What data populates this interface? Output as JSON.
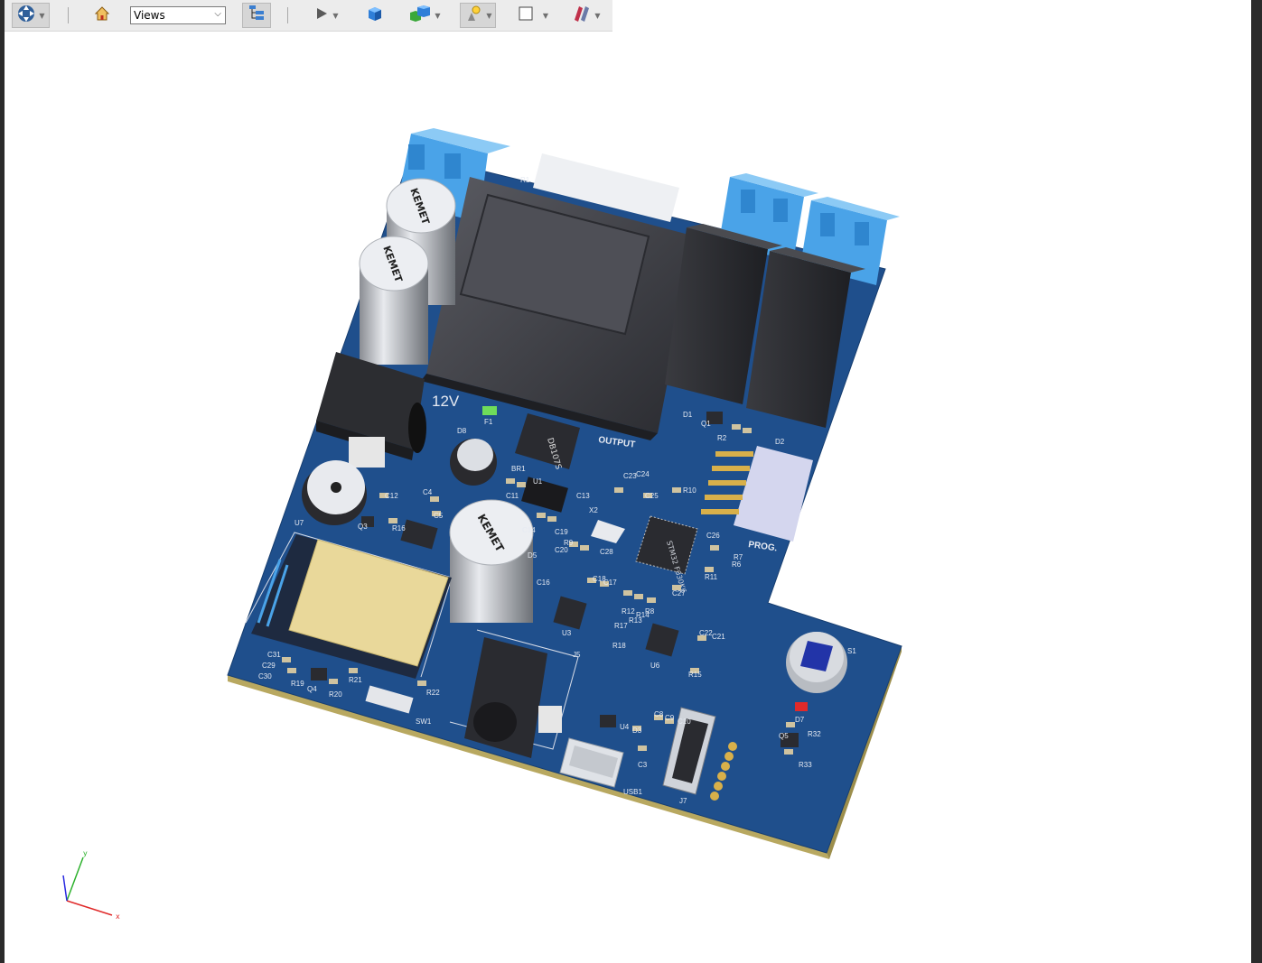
{
  "toolbar": {
    "views_label": "Views",
    "icons": [
      "navigate-icon",
      "home-icon",
      "model-tree-icon",
      "play-icon",
      "box-view-icon",
      "multi-box-icon",
      "lighting-icon",
      "display-mode-icon",
      "section-icon"
    ]
  },
  "board": {
    "silkscreen": {
      "power_label": "12V",
      "output_label": "OUTPUT",
      "prog_label": "PROG.",
      "bridge_rect": "DB107S",
      "capacitor_brand": "KEMET",
      "refs": {
        "R1": "R1",
        "F1": "F1",
        "D8": "D8",
        "BR1": "BR1",
        "U1": "U1",
        "U7": "U7",
        "Q3": "Q3",
        "R16": "R16",
        "C12": "C12",
        "C4": "C4",
        "C5": "C5",
        "C1": "C1",
        "C11": "C11",
        "C13": "C13",
        "C14": "C14",
        "C19": "C19",
        "X2": "X2",
        "R9": "R9",
        "C20": "C20",
        "D5": "D5",
        "C23": "C23",
        "C24": "C24",
        "C25": "C25",
        "C26": "C26",
        "R10": "R10",
        "C28": "C28",
        "C16": "C16",
        "C18": "C18",
        "C17": "C17",
        "U3": "U3",
        "R7": "R7",
        "R6": "R6",
        "R11": "R11",
        "C27": "C27",
        "D1": "D1",
        "Q1": "Q1",
        "R2": "R2",
        "D2": "D2",
        "U6": "U6",
        "C22": "C22",
        "C21": "C21",
        "R15": "R15",
        "J5": "J5",
        "C31": "C31",
        "C29": "C29",
        "C30": "C30",
        "R19": "R19",
        "Q4": "Q4",
        "R20": "R20",
        "R21": "R21",
        "R22": "R22",
        "SW1": "SW1",
        "U4": "U4",
        "D3": "D3",
        "C8": "C8",
        "C9": "C9",
        "C10": "C10",
        "C3": "C3",
        "USB1": "USB1",
        "J7": "J7",
        "S1": "S1",
        "D7": "D7",
        "Q5": "Q5",
        "R32": "R32",
        "R33": "R33",
        "R17": "R17",
        "R18": "R18",
        "R13": "R13",
        "R14": "R14",
        "R12": "R12",
        "R8": "R8"
      },
      "mcu_text": "STM32 F030K6"
    }
  },
  "axis": {
    "x": "x",
    "y": "y"
  },
  "colors": {
    "pcb": "#1f4f8c",
    "pcb_edge": "#b8a860",
    "terminal": "#4aa3e8",
    "relay": "#2a2a2e",
    "gold": "#d8b04a"
  }
}
